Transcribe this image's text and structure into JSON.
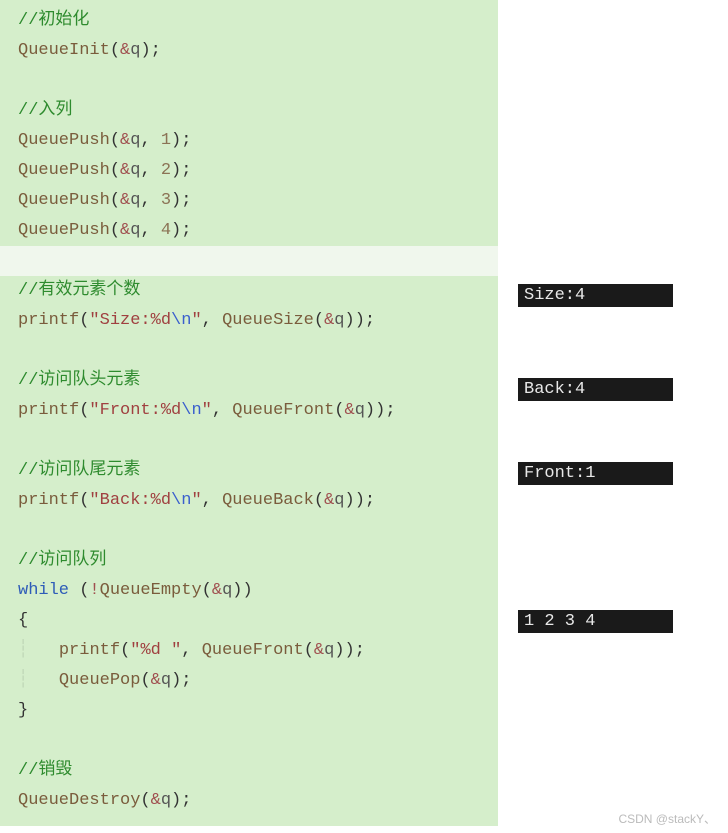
{
  "code": {
    "c_init": "//初始化",
    "l_init": "QueueInit(&q);",
    "c_push": "//入列",
    "l_push1_a": "QueuePush(&q, ",
    "l_push1_n": "1",
    "l_push2_n": "2",
    "l_push3_n": "3",
    "l_push4_n": "4",
    "l_push_end": ");",
    "c_size": "//有效元素个数",
    "l_size_pre": "printf(",
    "l_size_str": "\"Size:%d",
    "l_esc": "\\n",
    "l_size_str2": "\"",
    "l_size_mid": ", QueueSize(&q));",
    "c_front": "//访问队头元素",
    "l_front_str": "\"Front:%d",
    "l_front_mid": ", QueueFront(&q));",
    "c_back": "//访问队尾元素",
    "l_back_str": "\"Back:%d",
    "l_back_mid": ", QueueBack(&q));",
    "c_visit": "//访问队列",
    "kw_while": "while",
    "l_while_cond": " (!QueueEmpty(&q))",
    "l_obrace": "{",
    "l_loop1_pre": "    printf(",
    "l_loop1_str": "\"%d \"",
    "l_loop1_mid": ", QueueFront(&q));",
    "l_loop2": "    QueuePop(&q);",
    "l_cbrace": "}",
    "c_destroy": "//销毁",
    "l_destroy": "QueueDestroy(&q);"
  },
  "output": {
    "size": "Size:4",
    "back": "Back:4",
    "front": "Front:1",
    "all": "1 2 3 4"
  },
  "watermark": "CSDN @stackY、"
}
